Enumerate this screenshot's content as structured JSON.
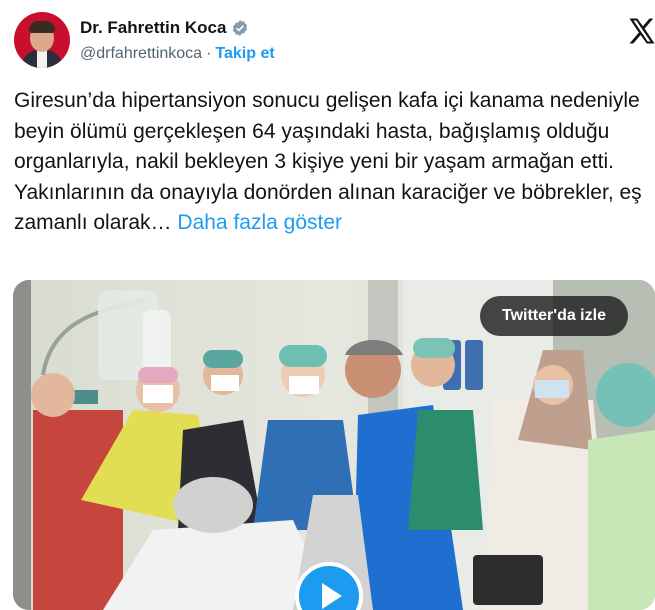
{
  "tweet": {
    "author_name": "Dr. Fahrettin Koca",
    "handle": "@drfahrettinkoca",
    "separator": "·",
    "follow_label": "Takip et",
    "text": "Giresun’da hipertansiyon sonucu gelişen kafa içi kanama nedeniyle beyin ölümü gerçekleşen 64 yaşındaki hasta, bağışlamış olduğu organlarıyla, nakil bekleyen 3 kişiye yeni bir yaşam armağan etti. Yakınlarının da onayıyla donörden alınan karaciğer ve böbrekler, eş zamanlı olarak… ",
    "show_more": "Daha fazla göster"
  },
  "media": {
    "watch_label": "Twitter'da izle"
  },
  "colors": {
    "accent": "#1d9bf0",
    "text": "#0f1419",
    "muted": "#536471"
  },
  "icons": [
    "verified-badge-icon",
    "x-logo-icon",
    "play-icon"
  ]
}
